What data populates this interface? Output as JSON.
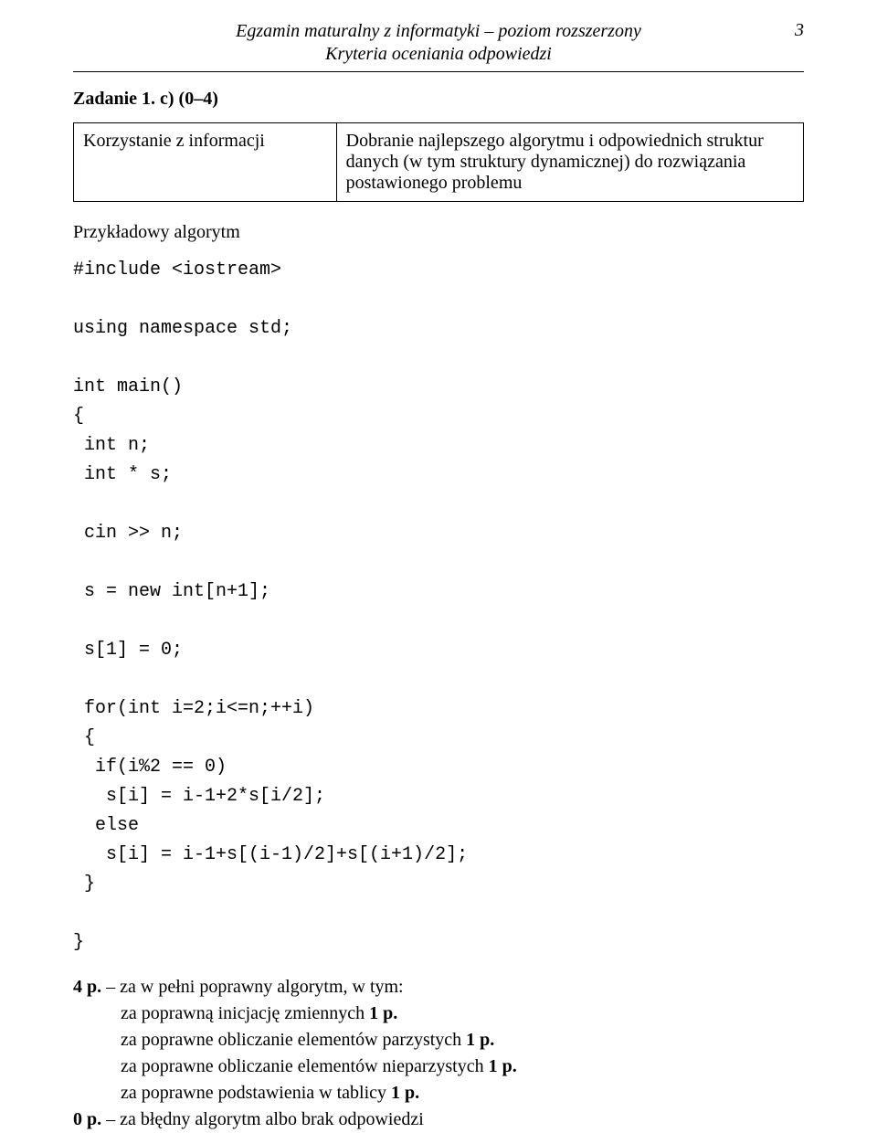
{
  "header": {
    "line1": "Egzamin maturalny z informatyki – poziom rozszerzony",
    "line2": "Kryteria oceniania odpowiedzi",
    "page_number": "3"
  },
  "task": {
    "title": "Zadanie 1. c) (0–4)",
    "table": {
      "left": "Korzystanie z informacji",
      "right": "Dobranie najlepszego algorytmu i odpowiednich struktur danych (w tym struktury dynamicznej) do rozwiązania postawionego problemu"
    }
  },
  "algorithm_label": "Przykładowy algorytm",
  "code": "#include <iostream>\n\nusing namespace std;\n\nint main()\n{\n int n;\n int * s;\n\n cin >> n;\n\n s = new int[n+1];\n\n s[1] = 0;\n\n for(int i=2;i<=n;++i)\n {\n  if(i%2 == 0)\n   s[i] = i-1+2*s[i/2];\n  else\n   s[i] = i-1+s[(i-1)/2]+s[(i+1)/2];\n }\n\n}",
  "scoring": {
    "line1_prefix": "4 p.",
    "line1_rest": " – za w pełni poprawny algorytm, w tym:",
    "indent1a": "za poprawną inicjację zmiennych ",
    "indent1a_bold": "1 p.",
    "indent2a": "za poprawne obliczanie elementów parzystych ",
    "indent2a_bold": "1 p.",
    "indent3a": "za poprawne obliczanie elementów nieparzystych ",
    "indent3a_bold": "1 p.",
    "indent4a": "za poprawne podstawienia w tablicy ",
    "indent4a_bold": "1 p.",
    "line2_prefix": "0 p.",
    "line2_rest": " – za błędny algorytm albo brak odpowiedzi"
  }
}
